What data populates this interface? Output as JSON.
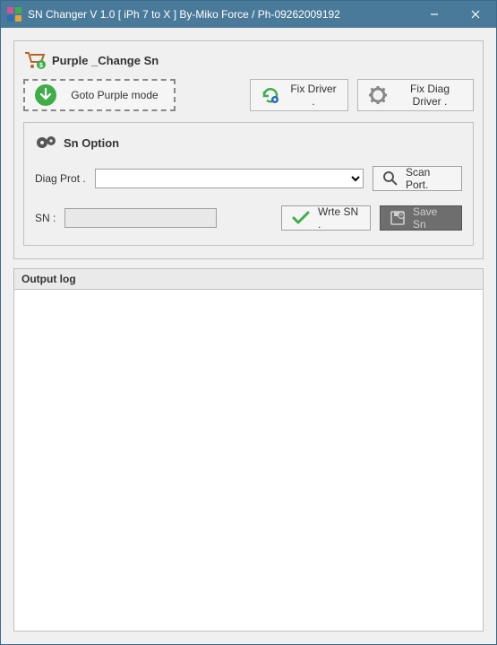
{
  "window": {
    "title": "SN Changer V 1.0   [ iPh 7 to X ] By-Miko Force  / Ph-09262009192"
  },
  "main": {
    "header": "Purple  _Change Sn",
    "buttons": {
      "goto_purple": "Goto Purple mode",
      "fix_driver": "Fix Driver .",
      "fix_diag_driver": "Fix Diag Driver ."
    }
  },
  "sn_option": {
    "header": "Sn Option",
    "diag_prot_label": "Diag Prot .",
    "diag_prot_value": "",
    "scan_port": "Scan Port.",
    "sn_label": "SN :",
    "sn_value": "",
    "write_sn": "Wrte SN .",
    "save_sn": "Save Sn"
  },
  "output": {
    "header": "Output log"
  }
}
